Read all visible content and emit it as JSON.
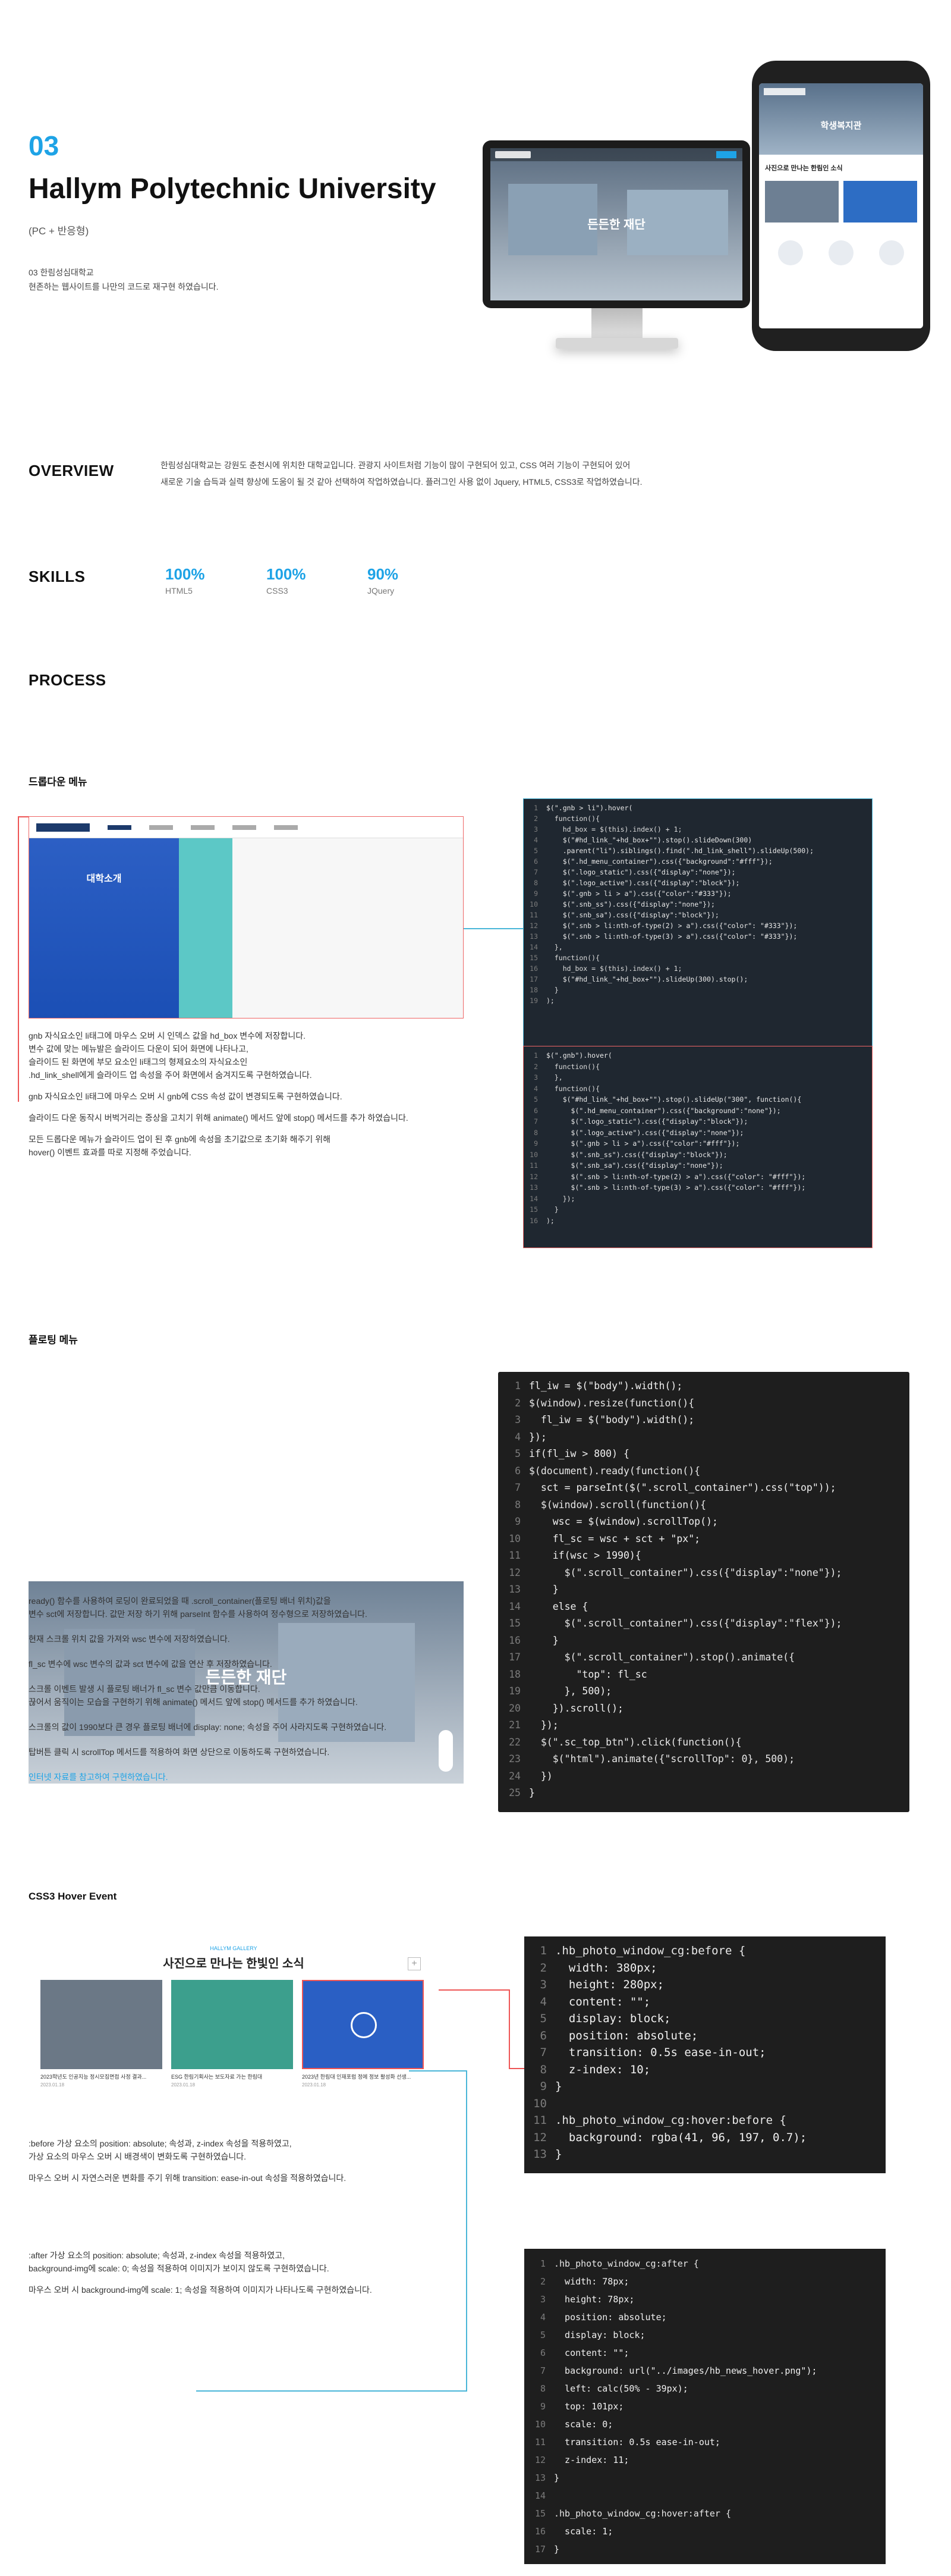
{
  "hero": {
    "number": "03",
    "title": "Hallym Polytechnic University",
    "subtitle": "(PC + 반응형)",
    "desc1": "03 한림성심대학교",
    "desc2": "현존하는 웹사이트를 나만의 코드로 재구현 하였습니다.",
    "monitor_banner": "든든한 재단",
    "phone_banner": "학생복지관",
    "phone_news": "사진으로 만나는 한림인 소식"
  },
  "overview": {
    "heading": "OVERVIEW",
    "line1": "한림성심대학교는 강원도 춘천시에 위치한 대학교입니다. 관광지 사이트처럼 기능이 많이 구현되어 있고, CSS 여러 기능이 구현되어 있어",
    "line2": "새로운 기술 습득과 실력 향상에 도움이 될 것 같아 선택하여 작업하였습니다. 플러그인 사용 없이 Jquery, HTML5, CSS3로 작업하였습니다."
  },
  "skills": {
    "heading": "SKILLS",
    "items": [
      {
        "value": "100%",
        "label": "HTML5"
      },
      {
        "value": "100%",
        "label": "CSS3"
      },
      {
        "value": "90%",
        "label": "JQuery"
      }
    ]
  },
  "process": {
    "heading": "PROCESS"
  },
  "dropdown": {
    "heading": "드롭다운 메뉴",
    "site_title": "대학소개",
    "notes": [
      "gnb 자식요소인 li태그에 마우스 오버 시 인덱스 값을 hd_box 변수에 저장합니다.",
      "변수 값에 맞는 메뉴발은 슬라이드 다운이 되어 화면에 나타나고,",
      "슬라이드 된 화면에 부모 요소인 li태그의 형제요소의 자식요소인",
      ".hd_link_shell에게 슬라이드 업 속성을 주어 화면에서 숨겨지도록 구현하였습니다.",
      "gnb 자식요소인 li태그에 마우스 오버 시 gnb에 CSS 속성 값이 변경되도록 구현하였습니다.",
      "슬라이드 다운 동작시 버벅거리는 증상을 고치기 위해 animate() 메서드 앞에 stop() 메서드를 추가 하였습니다.",
      "모든 드롭다운 메뉴가 슬라이드 업이 된 후 gnb에 속성을 초기값으로 초기화 해주기 위해",
      "hover() 이벤트 효과를 따로 지정해 주었습니다."
    ],
    "code1": [
      "$(\".gnb > li\").hover(",
      "  function(){",
      "    hd_box = $(this).index() + 1;",
      "    $(\"#hd_link_\"+hd_box+\"\").stop().slideDown(300)",
      "    .parent(\"li\").siblings().find(\".hd_link_shell\").slideUp(500);",
      "    $(\".hd_menu_container\").css({\"background\":\"#fff\"});",
      "    $(\".logo_static\").css({\"display\":\"none\"});",
      "    $(\".logo_active\").css({\"display\":\"block\"});",
      "    $(\".gnb > li > a\").css({\"color\":\"#333\"});",
      "    $(\".snb_ss\").css({\"display\":\"none\"});",
      "    $(\".snb_sa\").css({\"display\":\"block\"});",
      "    $(\".snb > li:nth-of-type(2) > a\").css({\"color\": \"#333\"});",
      "    $(\".snb > li:nth-of-type(3) > a\").css({\"color\": \"#333\"});",
      "  },",
      "  function(){",
      "    hd_box = $(this).index() + 1;",
      "    $(\"#hd_link_\"+hd_box+\"\").slideUp(300).stop();",
      "  }",
      ");"
    ],
    "code2": [
      "$(\".gnb\").hover(",
      "  function(){",
      "  },",
      "  function(){",
      "    $(\"#hd_link_\"+hd_box+\"\").stop().slideUp(\"300\", function(){",
      "      $(\".hd_menu_container\").css({\"background\":\"none\"});",
      "      $(\".logo_static\").css({\"display\":\"block\"});",
      "      $(\".logo_active\").css({\"display\":\"none\"});",
      "      $(\".gnb > li > a\").css({\"color\":\"#fff\"});",
      "      $(\".snb_ss\").css({\"display\":\"block\"});",
      "      $(\".snb_sa\").css({\"display\":\"none\"});",
      "      $(\".snb > li:nth-of-type(2) > a\").css({\"color\": \"#fff\"});",
      "      $(\".snb > li:nth-of-type(3) > a\").css({\"color\": \"#fff\"});",
      "    });",
      "  }",
      ");"
    ]
  },
  "floating": {
    "heading": "플로팅 메뉴",
    "banner": "든든한 재단",
    "notes": [
      "ready() 함수를 사용하여 로딩이 완료되었을 때 .scroll_container(플로팅 배너 위치)값을",
      "변수 sct에 저장합니다. 값만 저장 하기 위해 parseInt 함수를 사용하여 정수형으로 저장하였습니다.",
      "현재 스크롤 위치 값을 가져와 wsc 변수에 저장하였습니다.",
      "fl_sc 변수에 wsc 변수의 값과 sct 변수에 값을 연산 후 저장하였습니다.",
      "스크롤 이벤트 발생 시 플로팅 배너가 fl_sc 변수 값만큼 이동합니다.",
      "끊어서 움직이는 모습을 구현하기 위해 animate() 메서드 앞에 stop() 메서드를 추가 하였습니다.",
      "스크롤의 값이 1990보다 큰 경우 플로팅 배너에 display: none; 속성을 주어 사라지도록 구현하였습니다.",
      "탑버튼 클릭 시 scrollTop 메서드를 적용하여 화면 상단으로 이동하도록 구현하였습니다.",
      "인터넷 자료를 참고하여 구현하였습니다."
    ],
    "code": [
      "fl_iw = $(\"body\").width();",
      "$(window).resize(function(){",
      "  fl_iw = $(\"body\").width();",
      "});",
      "if(fl_iw > 800) {",
      "$(document).ready(function(){",
      "  sct = parseInt($(\".scroll_container\").css(\"top\"));",
      "  $(window).scroll(function(){",
      "    wsc = $(window).scrollTop();",
      "    fl_sc = wsc + sct + \"px\";",
      "    if(wsc > 1990){",
      "      $(\".scroll_container\").css({\"display\":\"none\"});",
      "    }",
      "    else {",
      "      $(\".scroll_container\").css({\"display\":\"flex\"});",
      "    }",
      "      $(\".scroll_container\").stop().animate({",
      "        \"top\": fl_sc",
      "      }, 500);",
      "    }).scroll();",
      "  });",
      "  $(\".sc_top_btn\").click(function(){",
      "    $(\"html\").animate({\"scrollTop\": 0}, 500);",
      "  })",
      "}"
    ]
  },
  "hover": {
    "heading": "CSS3 Hover Event",
    "gallery_tag": "HALLYM GALLERY",
    "gallery_title": "사진으로 만나는 한빛인 소식",
    "plus": "+",
    "cards": [
      {
        "caption": "2023학년도 인공지능 정시모집면접 사정 결과...",
        "date": "2023.01.18"
      },
      {
        "caption": "ESG 한림기획사는 보도자료 가는 한림대",
        "date": "2023.01.18"
      },
      {
        "caption": "2023년 한림대 인재포럼 정에 정보 활성화 선생...",
        "date": "2023.01.18"
      }
    ],
    "notes_before": [
      ":before 가상 요소의 position: absolute; 속성과, z-index 속성을 적용하였고,",
      "가상 요소의 마우스 오버 시 배경색이 변화도록 구현하였습니다.",
      "마우스 오버 시 자연스러운 변화를 주기 위해 transition: ease-in-out 속성을 적용하였습니다."
    ],
    "notes_after": [
      ":after 가상 요소의 position: absolute; 속성과, z-index 속성을 적용하였고,",
      "background-img에 scale: 0; 속성을 적용하여 이미지가 보이지 않도록 구현하였습니다.",
      "마우스 오버 시 background-img에 scale: 1; 속성을 적용하여 이미지가 나타나도록 구현하였습니다."
    ],
    "code1": [
      ".hb_photo_window_cg:before {",
      "  width: 380px;",
      "  height: 280px;",
      "  content: \"\";",
      "  display: block;",
      "  position: absolute;",
      "  transition: 0.5s ease-in-out;",
      "  z-index: 10;",
      "}",
      "",
      ".hb_photo_window_cg:hover:before {",
      "  background: rgba(41, 96, 197, 0.7);",
      "}"
    ],
    "code2": [
      ".hb_photo_window_cg:after {",
      "  width: 78px;",
      "  height: 78px;",
      "  position: absolute;",
      "  display: block;",
      "  content: \"\";",
      "  background: url(\"../images/hb_news_hover.png\");",
      "  left: calc(50% - 39px);",
      "  top: 101px;",
      "  scale: 0;",
      "  transition: 0.5s ease-in-out;",
      "  z-index: 11;",
      "}",
      "",
      ".hb_photo_window_cg:hover:after {",
      "  scale: 1;",
      "}"
    ]
  }
}
